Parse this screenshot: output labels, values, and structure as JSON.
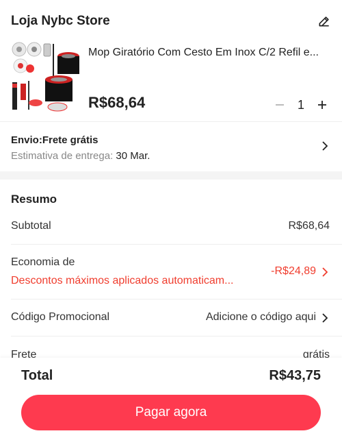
{
  "store": {
    "name": "Loja Nybc Store",
    "edit_icon": "pencil-icon"
  },
  "product": {
    "title": "Mop Giratório Com Cesto Em Inox C/2 Refil e...",
    "price": "R$68,64",
    "quantity": "1",
    "decrease_icon": "minus-icon",
    "increase_icon": "plus-icon"
  },
  "shipping": {
    "title": "Envio:Frete grátis",
    "estimate_label": "Estimativa de entrega:",
    "estimate_date": "30 Mar."
  },
  "summary": {
    "title": "Resumo",
    "subtotal_label": "Subtotal",
    "subtotal_value": "R$68,64",
    "savings_label": "Economia de",
    "savings_detail": "Descontos máximos aplicados automaticam...",
    "savings_value": "-R$24,89",
    "promo_label": "Código Promocional",
    "promo_value": "Adicione o código aqui",
    "shipping_label": "Frete",
    "shipping_value": "grátis"
  },
  "footer": {
    "total_label": "Total",
    "total_value": "R$43,75",
    "pay_button": "Pagar agora"
  },
  "colors": {
    "accent": "#fe3a4f",
    "discount": "#f03d2e"
  }
}
